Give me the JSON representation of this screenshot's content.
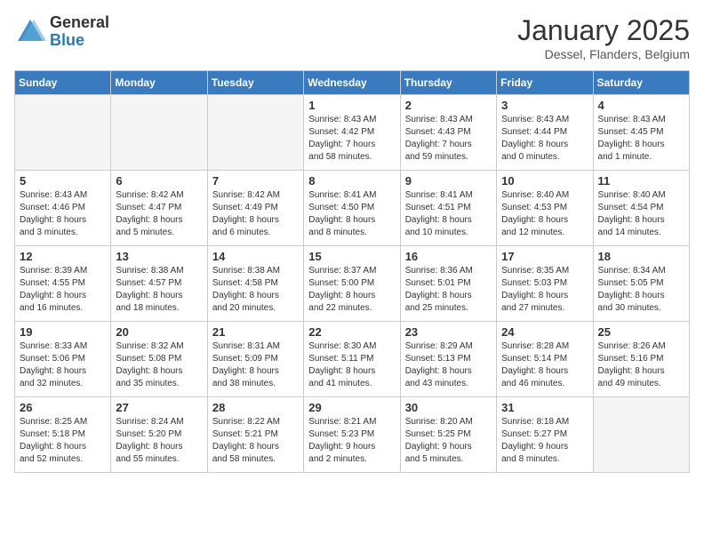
{
  "header": {
    "logo": {
      "general": "General",
      "blue": "Blue"
    },
    "title": "January 2025",
    "subtitle": "Dessel, Flanders, Belgium"
  },
  "days_of_week": [
    "Sunday",
    "Monday",
    "Tuesday",
    "Wednesday",
    "Thursday",
    "Friday",
    "Saturday"
  ],
  "weeks": [
    [
      {
        "day": "",
        "info": ""
      },
      {
        "day": "",
        "info": ""
      },
      {
        "day": "",
        "info": ""
      },
      {
        "day": "1",
        "info": "Sunrise: 8:43 AM\nSunset: 4:42 PM\nDaylight: 7 hours\nand 58 minutes."
      },
      {
        "day": "2",
        "info": "Sunrise: 8:43 AM\nSunset: 4:43 PM\nDaylight: 7 hours\nand 59 minutes."
      },
      {
        "day": "3",
        "info": "Sunrise: 8:43 AM\nSunset: 4:44 PM\nDaylight: 8 hours\nand 0 minutes."
      },
      {
        "day": "4",
        "info": "Sunrise: 8:43 AM\nSunset: 4:45 PM\nDaylight: 8 hours\nand 1 minute."
      }
    ],
    [
      {
        "day": "5",
        "info": "Sunrise: 8:43 AM\nSunset: 4:46 PM\nDaylight: 8 hours\nand 3 minutes."
      },
      {
        "day": "6",
        "info": "Sunrise: 8:42 AM\nSunset: 4:47 PM\nDaylight: 8 hours\nand 5 minutes."
      },
      {
        "day": "7",
        "info": "Sunrise: 8:42 AM\nSunset: 4:49 PM\nDaylight: 8 hours\nand 6 minutes."
      },
      {
        "day": "8",
        "info": "Sunrise: 8:41 AM\nSunset: 4:50 PM\nDaylight: 8 hours\nand 8 minutes."
      },
      {
        "day": "9",
        "info": "Sunrise: 8:41 AM\nSunset: 4:51 PM\nDaylight: 8 hours\nand 10 minutes."
      },
      {
        "day": "10",
        "info": "Sunrise: 8:40 AM\nSunset: 4:53 PM\nDaylight: 8 hours\nand 12 minutes."
      },
      {
        "day": "11",
        "info": "Sunrise: 8:40 AM\nSunset: 4:54 PM\nDaylight: 8 hours\nand 14 minutes."
      }
    ],
    [
      {
        "day": "12",
        "info": "Sunrise: 8:39 AM\nSunset: 4:55 PM\nDaylight: 8 hours\nand 16 minutes."
      },
      {
        "day": "13",
        "info": "Sunrise: 8:38 AM\nSunset: 4:57 PM\nDaylight: 8 hours\nand 18 minutes."
      },
      {
        "day": "14",
        "info": "Sunrise: 8:38 AM\nSunset: 4:58 PM\nDaylight: 8 hours\nand 20 minutes."
      },
      {
        "day": "15",
        "info": "Sunrise: 8:37 AM\nSunset: 5:00 PM\nDaylight: 8 hours\nand 22 minutes."
      },
      {
        "day": "16",
        "info": "Sunrise: 8:36 AM\nSunset: 5:01 PM\nDaylight: 8 hours\nand 25 minutes."
      },
      {
        "day": "17",
        "info": "Sunrise: 8:35 AM\nSunset: 5:03 PM\nDaylight: 8 hours\nand 27 minutes."
      },
      {
        "day": "18",
        "info": "Sunrise: 8:34 AM\nSunset: 5:05 PM\nDaylight: 8 hours\nand 30 minutes."
      }
    ],
    [
      {
        "day": "19",
        "info": "Sunrise: 8:33 AM\nSunset: 5:06 PM\nDaylight: 8 hours\nand 32 minutes."
      },
      {
        "day": "20",
        "info": "Sunrise: 8:32 AM\nSunset: 5:08 PM\nDaylight: 8 hours\nand 35 minutes."
      },
      {
        "day": "21",
        "info": "Sunrise: 8:31 AM\nSunset: 5:09 PM\nDaylight: 8 hours\nand 38 minutes."
      },
      {
        "day": "22",
        "info": "Sunrise: 8:30 AM\nSunset: 5:11 PM\nDaylight: 8 hours\nand 41 minutes."
      },
      {
        "day": "23",
        "info": "Sunrise: 8:29 AM\nSunset: 5:13 PM\nDaylight: 8 hours\nand 43 minutes."
      },
      {
        "day": "24",
        "info": "Sunrise: 8:28 AM\nSunset: 5:14 PM\nDaylight: 8 hours\nand 46 minutes."
      },
      {
        "day": "25",
        "info": "Sunrise: 8:26 AM\nSunset: 5:16 PM\nDaylight: 8 hours\nand 49 minutes."
      }
    ],
    [
      {
        "day": "26",
        "info": "Sunrise: 8:25 AM\nSunset: 5:18 PM\nDaylight: 8 hours\nand 52 minutes."
      },
      {
        "day": "27",
        "info": "Sunrise: 8:24 AM\nSunset: 5:20 PM\nDaylight: 8 hours\nand 55 minutes."
      },
      {
        "day": "28",
        "info": "Sunrise: 8:22 AM\nSunset: 5:21 PM\nDaylight: 8 hours\nand 58 minutes."
      },
      {
        "day": "29",
        "info": "Sunrise: 8:21 AM\nSunset: 5:23 PM\nDaylight: 9 hours\nand 2 minutes."
      },
      {
        "day": "30",
        "info": "Sunrise: 8:20 AM\nSunset: 5:25 PM\nDaylight: 9 hours\nand 5 minutes."
      },
      {
        "day": "31",
        "info": "Sunrise: 8:18 AM\nSunset: 5:27 PM\nDaylight: 9 hours\nand 8 minutes."
      },
      {
        "day": "",
        "info": ""
      }
    ]
  ]
}
